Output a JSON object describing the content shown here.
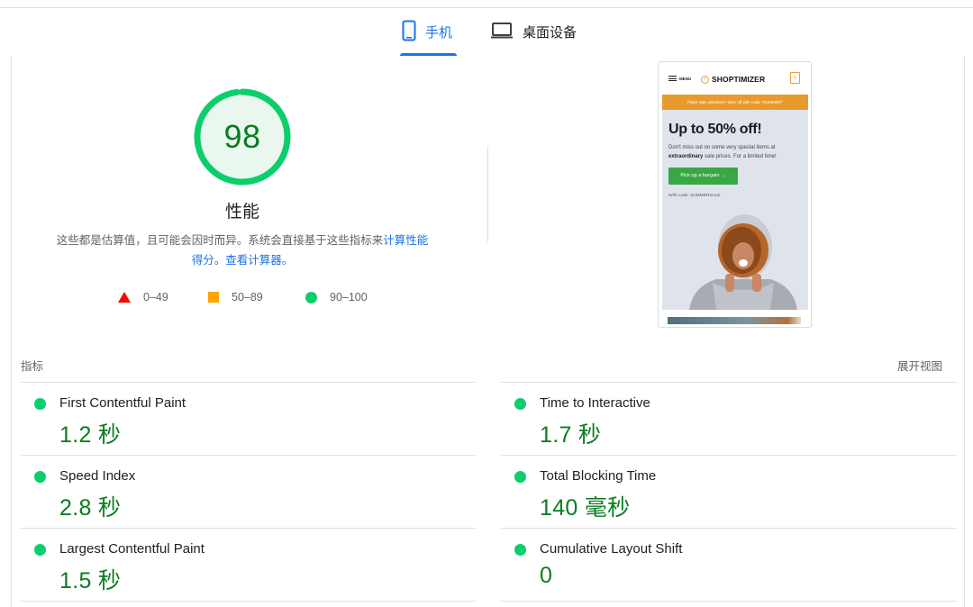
{
  "tabs": {
    "mobile_label": "手机",
    "desktop_label": "桌面设备"
  },
  "performance": {
    "score": "98",
    "score_value": 98,
    "title": "性能",
    "description_text": "这些都是估算值，且可能会因时而异。系统会直接基于这些指标来",
    "description_link1": "计算性能得分",
    "description_sep": "。",
    "description_link2": "查看计算器。"
  },
  "legend": {
    "fail_range": "0–49",
    "average_range": "50–89",
    "pass_range": "90–100"
  },
  "screenshot": {
    "menu_label": "MENU",
    "logo_text": "SHOPTIMIZER",
    "flash_banner": "Flash sale unlocked  •  25% off with code \"SUMMER\"",
    "hero_title": "Up to 50% off!",
    "hero_text_1": "Don't miss out on some very special items at",
    "hero_text_bold": "extraordinary",
    "hero_text_2": "sale prices. For a limited time!",
    "cta_label": "Pick up a bargain →",
    "code_text": "With code: SUMMERSALE"
  },
  "metrics_section": {
    "label": "指标",
    "expand_label": "展开视图"
  },
  "metrics": [
    {
      "name": "First Contentful Paint",
      "value": "1.2 秒"
    },
    {
      "name": "Time to Interactive",
      "value": "1.7 秒"
    },
    {
      "name": "Speed Index",
      "value": "2.8 秒"
    },
    {
      "name": "Total Blocking Time",
      "value": "140 毫秒"
    },
    {
      "name": "Largest Contentful Paint",
      "value": "1.5 秒"
    },
    {
      "name": "Cumulative Layout Shift",
      "value": "0"
    }
  ],
  "colors": {
    "pass": "#0cce6b",
    "pass_text": "#0a7d1f",
    "average": "#ffa400",
    "fail": "#eb0f00",
    "accent": "#1a73e8"
  },
  "icons": {
    "mobile_tab": "phone-icon",
    "desktop_tab": "laptop-icon"
  }
}
